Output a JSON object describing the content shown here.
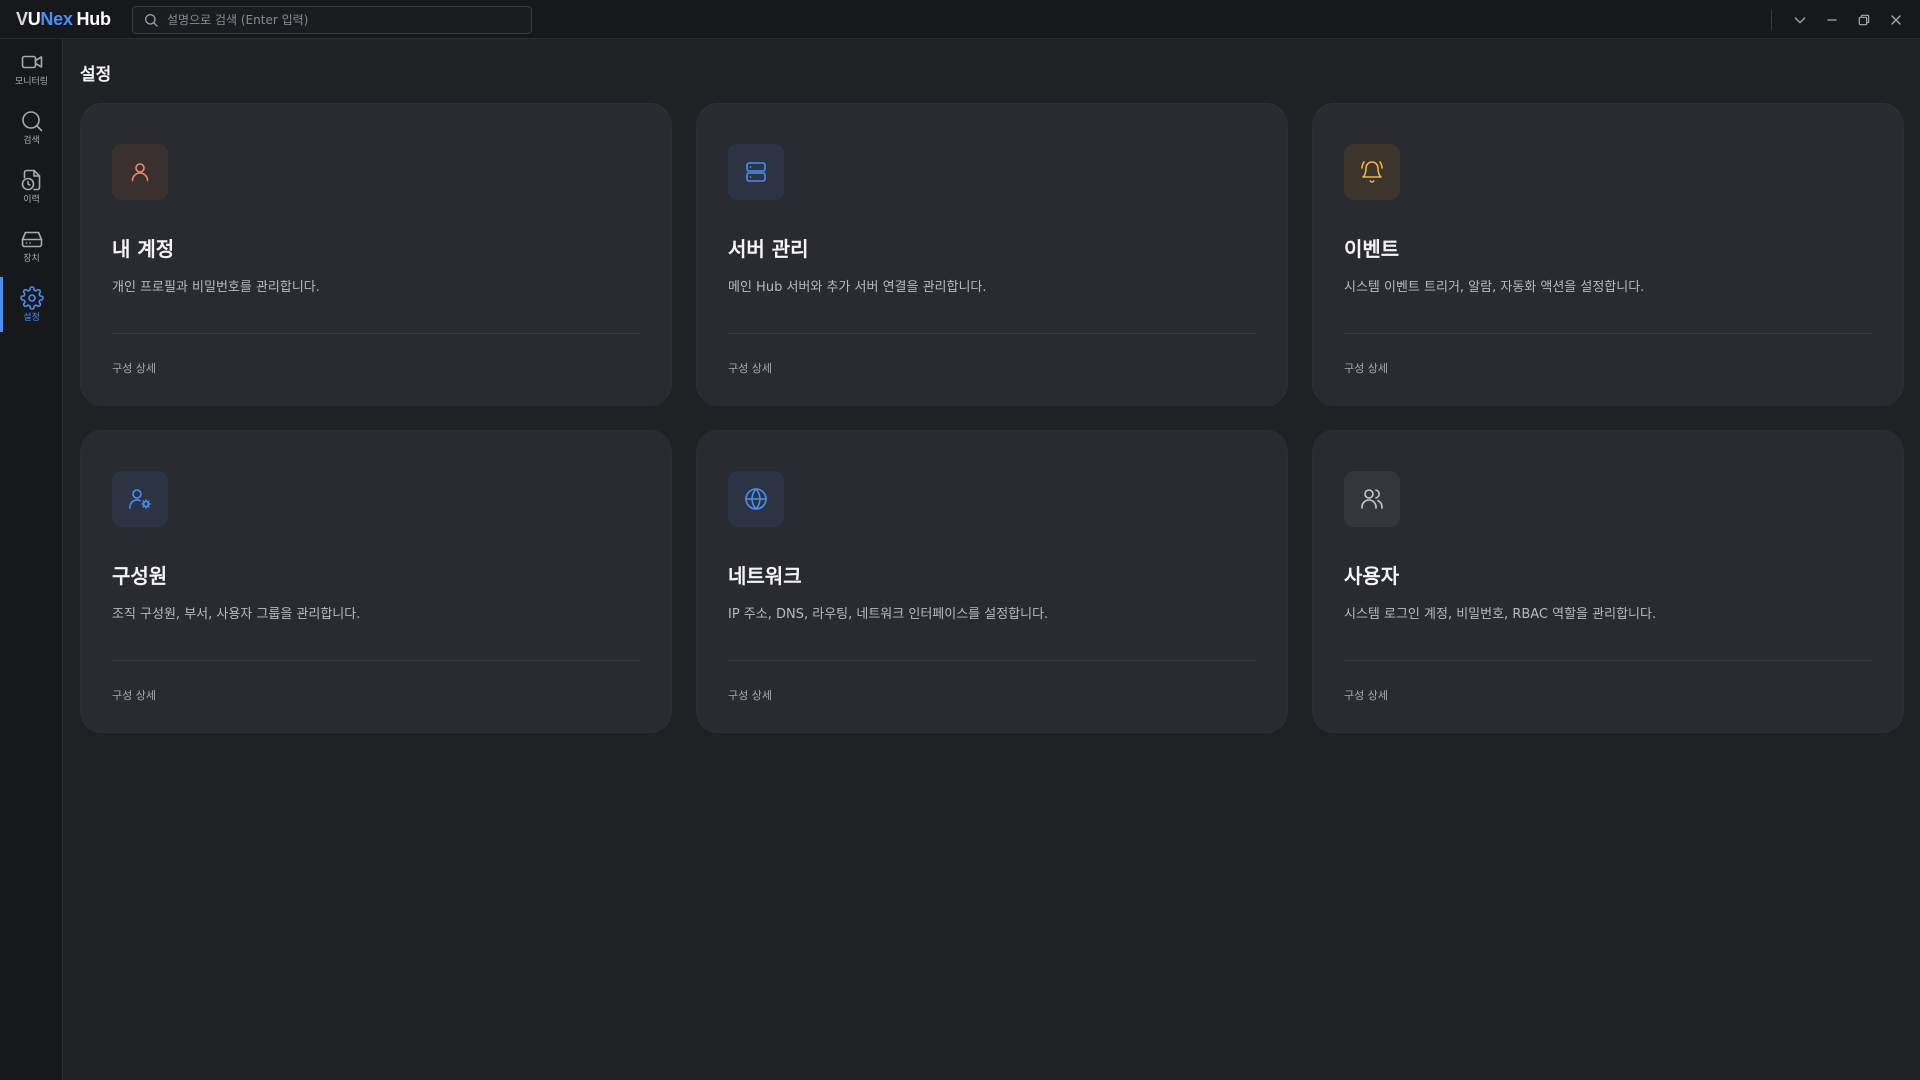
{
  "app": {
    "logo_v": "V",
    "logo_u": "U",
    "logo_nex": "Nex",
    "logo_hub": "Hub"
  },
  "search": {
    "placeholder": "설명으로 검색 (Enter 입력)"
  },
  "sidebar": {
    "items": [
      {
        "label": "모니터링",
        "icon": "video-camera-icon"
      },
      {
        "label": "검색",
        "icon": "search-icon"
      },
      {
        "label": "이력",
        "icon": "history-clock-icon"
      },
      {
        "label": "장치",
        "icon": "hard-drive-icon"
      },
      {
        "label": "설정",
        "icon": "gear-icon",
        "active": true
      }
    ]
  },
  "page": {
    "title": "설정"
  },
  "cards": [
    {
      "title": "내 계정",
      "desc": "개인 프로필과 비밀번호를 관리합니다.",
      "link": "구성 상세",
      "icon": "user-icon",
      "icon_color": "#f0866f",
      "icon_bg": "#3a302f"
    },
    {
      "title": "서버 관리",
      "desc": "메인 Hub 서버와 추가 서버 연결을 관리합니다.",
      "link": "구성 상세",
      "icon": "server-icon",
      "icon_color": "#4b8ef5",
      "icon_bg": "#2c3444"
    },
    {
      "title": "이벤트",
      "desc": "시스템 이벤트 트리거, 알람, 자동화 액션을 설정합니다.",
      "link": "구성 상세",
      "icon": "bell-ring-icon",
      "icon_color": "#f3b24a",
      "icon_bg": "#3b352c"
    },
    {
      "title": "구성원",
      "desc": "조직 구성원, 부서, 사용자 그룹을 관리합니다.",
      "link": "구성 상세",
      "icon": "user-cog-icon",
      "icon_color": "#4b8ef5",
      "icon_bg": "#2c3444"
    },
    {
      "title": "네트워크",
      "desc": "IP 주소, DNS, 라우팅, 네트워크 인터페이스를 설정합니다.",
      "link": "구성 상세",
      "icon": "globe-icon",
      "icon_color": "#4b8ef5",
      "icon_bg": "#2c3444"
    },
    {
      "title": "사용자",
      "desc": "시스템 로그인 계정, 비밀번호, RBAC 역할을 관리합니다.",
      "link": "구성 상세",
      "icon": "users-icon",
      "icon_color": "#c9cacf",
      "icon_bg": "#35363c"
    }
  ]
}
